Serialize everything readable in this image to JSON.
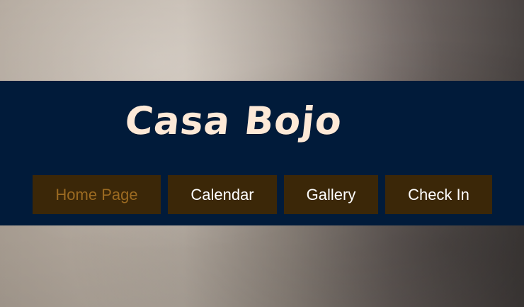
{
  "site": {
    "title": "Casa Bojo"
  },
  "nav": {
    "items": [
      {
        "label": "Home Page",
        "active": true
      },
      {
        "label": "Calendar",
        "active": false
      },
      {
        "label": "Gallery",
        "active": false
      },
      {
        "label": "Check In",
        "active": false
      }
    ]
  },
  "colors": {
    "header_bg": "#011b3a",
    "nav_bg": "#3b2708",
    "title_text": "#fde9d7",
    "nav_text": "#ffffff",
    "nav_active_text": "#9b6a21"
  }
}
